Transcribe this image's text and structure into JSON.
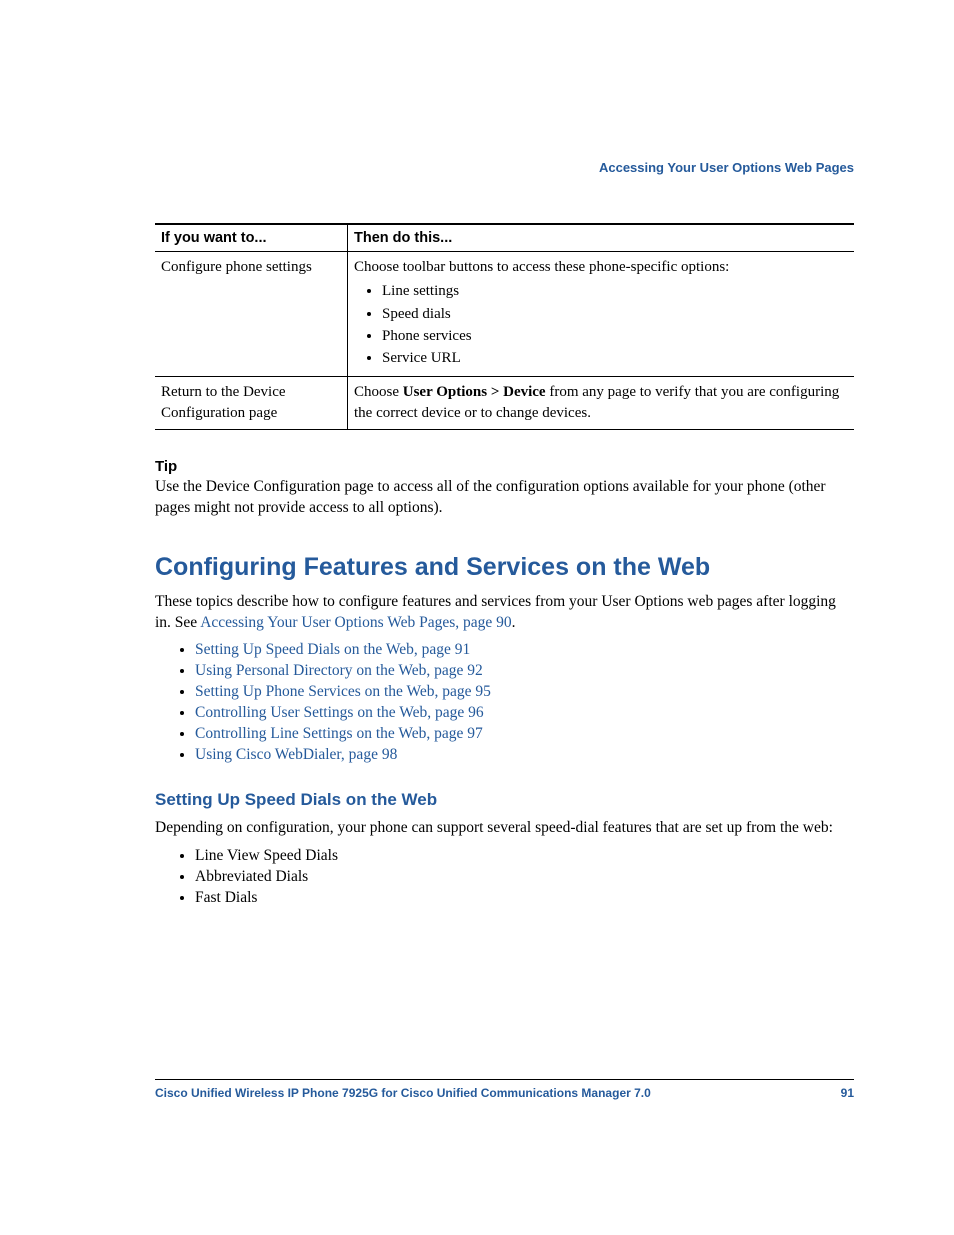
{
  "header": {
    "title": "Accessing Your User Options Web Pages"
  },
  "table": {
    "head": {
      "c1": "If you want to...",
      "c2": "Then do this..."
    },
    "row1": {
      "c1": "Configure phone settings",
      "c2_lead": "Choose toolbar buttons to access these phone-specific options:",
      "bullets": [
        "Line settings",
        "Speed dials",
        "Phone services",
        "Service URL"
      ]
    },
    "row2": {
      "c1": "Return to the Device Configuration page",
      "c2_pre": "Choose ",
      "c2_bold": "User Options > Device",
      "c2_post": " from any page to verify that you are configuring the correct device or to change devices."
    }
  },
  "tip": {
    "label": "Tip",
    "text": "Use the Device Configuration page to access all of the configuration options available for your phone (other pages might not provide access to all options)."
  },
  "section": {
    "title": "Configuring Features and Services on the Web",
    "intro_pre": "These topics describe how to configure features and services from your User Options web pages after logging in. See ",
    "intro_link": "Accessing Your User Options Web Pages, page 90",
    "intro_post": ".",
    "links": [
      "Setting Up Speed Dials on the Web, page 91",
      "Using Personal Directory on the Web, page 92",
      "Setting Up Phone Services on the Web, page 95",
      "Controlling User Settings on the Web, page 96",
      "Controlling Line Settings on the Web, page 97",
      "Using Cisco WebDialer, page 98"
    ]
  },
  "sub": {
    "title": "Setting Up Speed Dials on the Web",
    "intro": "Depending on configuration, your phone can support several speed-dial features that are set up from the web:",
    "items": [
      "Line View Speed Dials",
      "Abbreviated Dials",
      "Fast Dials"
    ]
  },
  "footer": {
    "left": "Cisco Unified Wireless IP Phone 7925G for Cisco Unified Communications Manager 7.0",
    "right": "91"
  }
}
